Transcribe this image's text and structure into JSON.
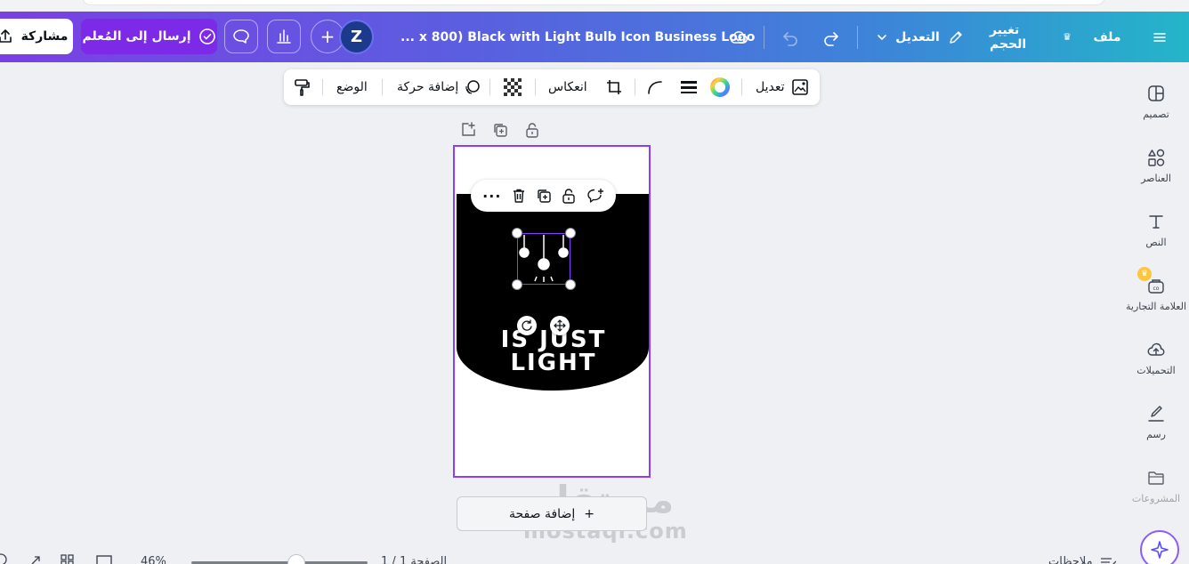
{
  "header": {
    "menu_icon": "hamburger-icon",
    "file_label": "ملف",
    "resize_label": "تغيير الحجم",
    "edit_label": "التعديل",
    "document_title": "... x 800) Black with Light Bulb Icon Business Logo",
    "avatar_initial": "Z",
    "send_to_teacher_label": "إرسال إلى المُعلم",
    "share_label": "مشاركة"
  },
  "toolbar": {
    "edit_image_label": "تعديل",
    "flip_label": "انعكاس",
    "animate_label": "إضافة حركة",
    "position_label": "الوضع"
  },
  "sidebar": {
    "items": [
      {
        "label": "تصميم",
        "icon": "layout-icon"
      },
      {
        "label": "العناصر",
        "icon": "elements-icon"
      },
      {
        "label": "النص",
        "icon": "text-icon"
      },
      {
        "label": "العلامة التجارية",
        "icon": "brand-icon"
      },
      {
        "label": "التحميلات",
        "icon": "upload-cloud-icon"
      },
      {
        "label": "رسم",
        "icon": "draw-icon"
      },
      {
        "label": "المشروعات",
        "icon": "folder-icon"
      }
    ]
  },
  "canvas": {
    "logo_line1": "IS JUST",
    "logo_line2": "LIGHT",
    "add_page_label": "إضافة صفحة",
    "add_page_plus": "+"
  },
  "watermark": {
    "arabic": "مستقل",
    "latin": "mostaql.com"
  },
  "footer": {
    "zoom": "46%",
    "page_indicator": "الصفحة 1 / 1",
    "notes_label": "ملاحظات"
  },
  "colors": {
    "accent": "#8b3dff",
    "teacher_button": "#7d2ae8",
    "header_gradient_start": "#7b3fe4",
    "header_gradient_end": "#24b5c9"
  }
}
